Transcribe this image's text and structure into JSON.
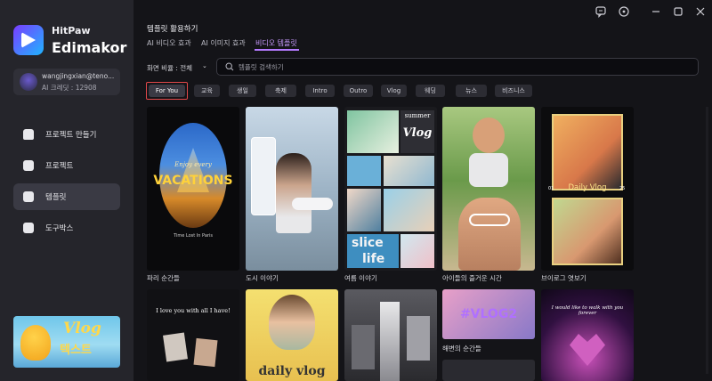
{
  "app": {
    "brand_line1": "HitPaw",
    "brand_line2": "Edimakor"
  },
  "user": {
    "email": "wangjingxian@teno...",
    "credit": "AI 크레딧 : 12908"
  },
  "sidebar": {
    "items": [
      {
        "label": "프로젝트 만들기",
        "icon": "home-icon"
      },
      {
        "label": "프로젝트",
        "icon": "folder-plus-icon"
      },
      {
        "label": "템플릿",
        "icon": "template-icon"
      },
      {
        "label": "도구박스",
        "icon": "toolbox-icon"
      }
    ],
    "active": "템플릿"
  },
  "promo": {
    "title": "Vlog",
    "subtitle": "텍스트"
  },
  "header": {
    "title": "템플릿 활용하기",
    "tabs": [
      "AI 비디오 효과",
      "AI 이미지 효과",
      "비디오 템플릿"
    ],
    "active_tab": "비디오 템플릿"
  },
  "filter": {
    "ratio_label": "화면 비율 : 전체",
    "search_placeholder": "템플릿 검색하기"
  },
  "chips": [
    "For You",
    "교육",
    "생일",
    "축제",
    "Intro",
    "Outro",
    "Vlog",
    "웨딩",
    "뉴스",
    "비즈니스"
  ],
  "active_chip": "For You",
  "templates": [
    {
      "label": "파리 순간들",
      "overlay_title": "Enjoy every",
      "overlay_main": "VACATIONS",
      "overlay_caption": "Time Lost In Paris"
    },
    {
      "label": "도시 이야기"
    },
    {
      "label": "여름 이야기",
      "overlay_top": "summer",
      "overlay_vlog": "Vlog",
      "overlay_bottom1": "slice",
      "overlay_bottom2": "life"
    },
    {
      "label": "아이들의 즐거운 시간"
    },
    {
      "label": "브이로그 엿보기",
      "overlay_date_left": "01",
      "overlay_main": "Daily Vlog",
      "overlay_date_right": "25"
    },
    {
      "label": "",
      "overlay": "I love you with all I have!"
    },
    {
      "label": "",
      "overlay": "daily vlog"
    },
    {
      "label": ""
    },
    {
      "label": "해변의 순간들",
      "overlay": "#VLOG2"
    },
    {
      "label": "",
      "overlay": "I would like to walk with you forever"
    }
  ],
  "colors": {
    "accent": "#b57bff",
    "highlight_border": "#e0484a",
    "sidebar_bg": "#25252b",
    "main_bg": "#141418"
  }
}
